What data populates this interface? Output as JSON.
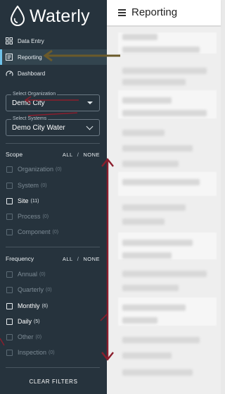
{
  "app": {
    "title": "Waterly"
  },
  "nav": {
    "items": [
      {
        "label": "Data Entry",
        "icon": "grid-icon",
        "active": false
      },
      {
        "label": "Reporting",
        "icon": "report-icon",
        "active": true
      },
      {
        "label": "Dashboard",
        "icon": "gauge-icon",
        "active": false
      }
    ]
  },
  "filters": {
    "organization": {
      "label": "Select Organization",
      "value": "Demo City"
    },
    "systems": {
      "label": "Select Systems",
      "value": "Demo City Water"
    }
  },
  "scope": {
    "title": "Scope",
    "all_label": "ALL",
    "separator": "/",
    "none_label": "NONE",
    "items": [
      {
        "label": "Organization",
        "count": "(0)",
        "enabled": false
      },
      {
        "label": "System",
        "count": "(0)",
        "enabled": false
      },
      {
        "label": "Site",
        "count": "(11)",
        "enabled": true
      },
      {
        "label": "Process",
        "count": "(0)",
        "enabled": false
      },
      {
        "label": "Component",
        "count": "(0)",
        "enabled": false
      }
    ]
  },
  "frequency": {
    "title": "Frequency",
    "all_label": "ALL",
    "separator": "/",
    "none_label": "NONE",
    "items": [
      {
        "label": "Annual",
        "count": "(0)",
        "enabled": false
      },
      {
        "label": "Quarterly",
        "count": "(0)",
        "enabled": false
      },
      {
        "label": "Monthly",
        "count": "(6)",
        "enabled": true
      },
      {
        "label": "Daily",
        "count": "(5)",
        "enabled": true
      },
      {
        "label": "Other",
        "count": "(0)",
        "enabled": false
      },
      {
        "label": "Inspection",
        "count": "(0)",
        "enabled": false
      }
    ]
  },
  "clear_filters_label": "CLEAR FILTERS",
  "header": {
    "title": "Reporting",
    "menu_icon": "hamburger-icon"
  },
  "colors": {
    "sidebar_bg": "#26333d",
    "active_accent": "#6fc3ea",
    "annotation_arrow": "#8b1e2d",
    "annotation_arrow_olive": "#6b5a2a"
  }
}
